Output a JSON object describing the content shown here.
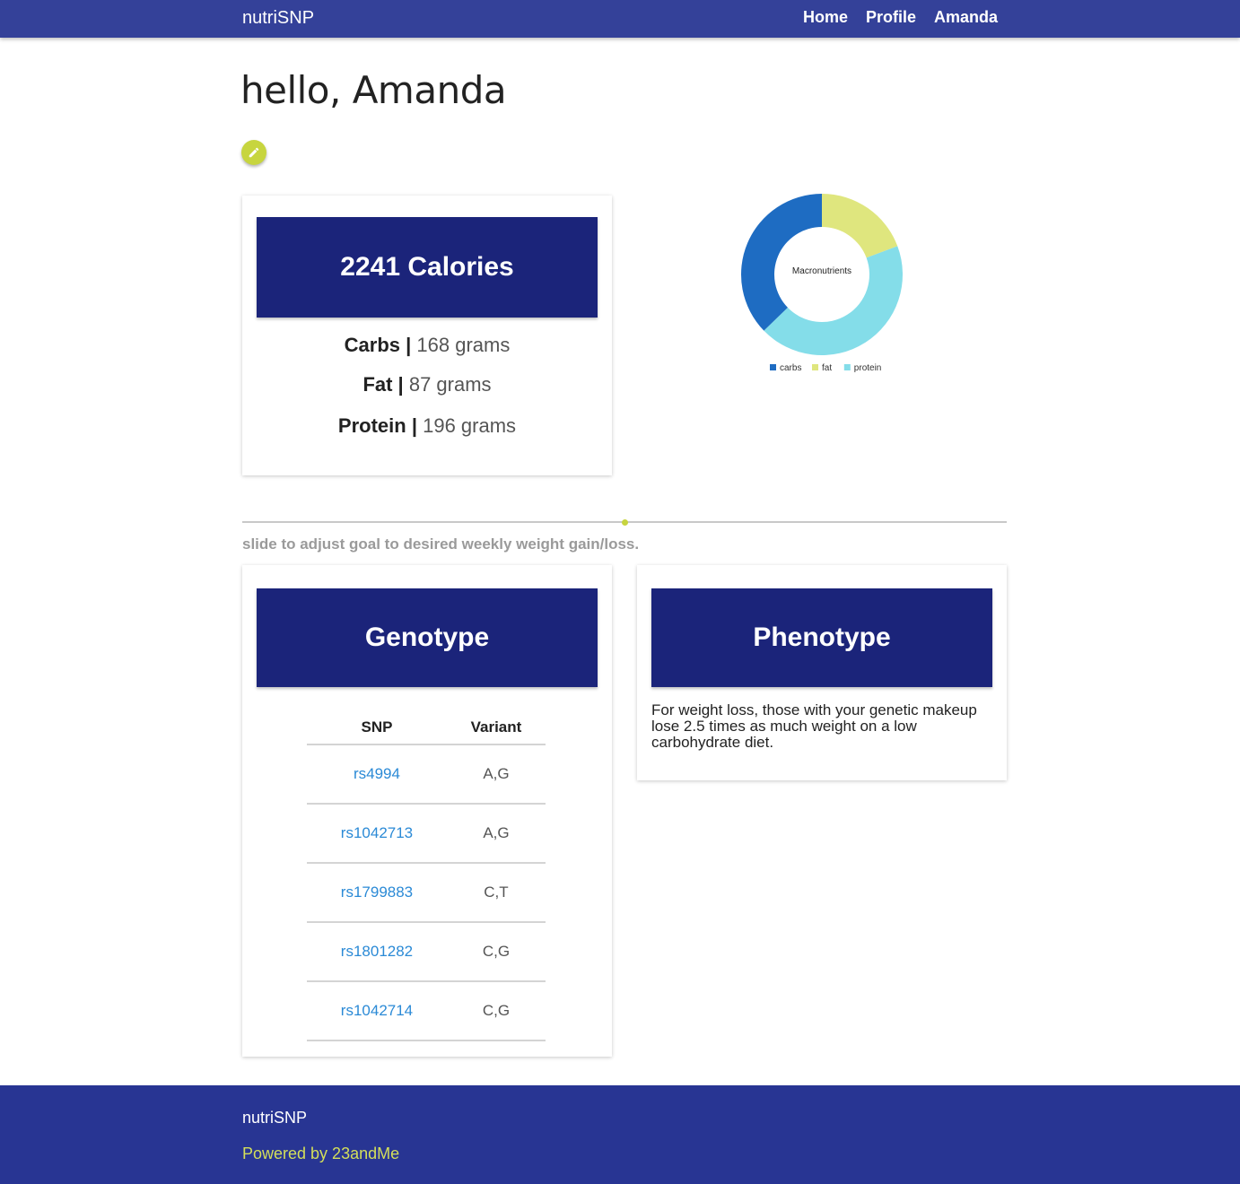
{
  "navbar": {
    "brand": "nutriSNP",
    "links": [
      "Home",
      "Profile",
      "Amanda"
    ]
  },
  "greeting": "hello, Amanda",
  "edit_button": {
    "icon": "pencil-icon"
  },
  "calories_card": {
    "title": "2241 Calories",
    "macros": [
      {
        "name": "Carbs",
        "separator": " | ",
        "value": "168 grams"
      },
      {
        "name": "Fat",
        "separator": " | ",
        "value": "87 grams"
      },
      {
        "name": "Protein",
        "separator": " | ",
        "value": "196 grams"
      }
    ]
  },
  "chart_data": {
    "type": "pie",
    "variant": "doughnut",
    "title": "",
    "center_label": "Macronutrients",
    "categories": [
      "carbs",
      "fat",
      "protein"
    ],
    "values": [
      168,
      87,
      196
    ],
    "colors": [
      "#1e6cc2",
      "#dfe67e",
      "#84dde9"
    ],
    "legend": "bottom"
  },
  "slider": {
    "caption": "slide to adjust goal to desired weekly weight gain/loss.",
    "value_fraction": 0.5
  },
  "genotype_card": {
    "title": "Genotype",
    "columns": [
      "SNP",
      "Variant"
    ],
    "rows": [
      {
        "snp": "rs4994",
        "variant": "A,G"
      },
      {
        "snp": "rs1042713",
        "variant": "A,G"
      },
      {
        "snp": "rs1799883",
        "variant": "C,T"
      },
      {
        "snp": "rs1801282",
        "variant": "C,G"
      },
      {
        "snp": "rs1042714",
        "variant": "C,G"
      }
    ]
  },
  "phenotype_card": {
    "title": "Phenotype",
    "text": "For weight loss, those with your genetic makeup lose 2.5 times as much weight on a low carbohydrate diet."
  },
  "footer": {
    "brand": "nutriSNP",
    "powered_by": "Powered by 23andMe"
  },
  "colors": {
    "navbar": "#344199",
    "card_header": "#1b247a",
    "accent": "#c7d53f",
    "link": "#2b8ad6",
    "footer": "#283593"
  }
}
